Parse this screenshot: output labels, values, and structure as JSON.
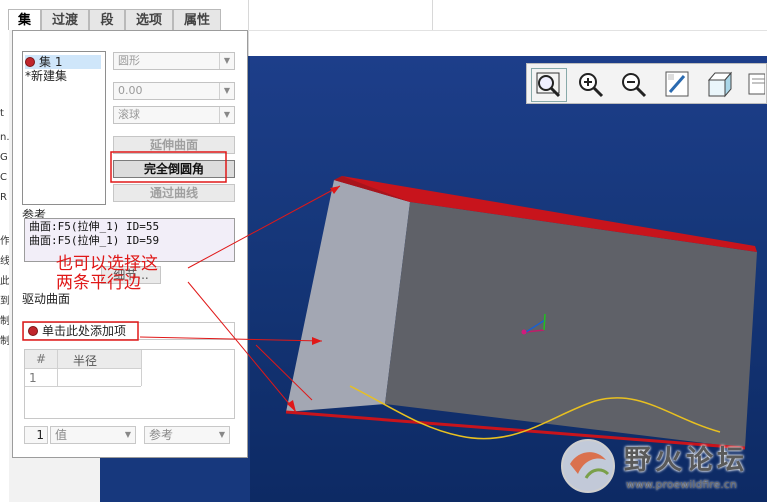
{
  "tabs": [
    {
      "label": "集",
      "active": true
    },
    {
      "label": "过渡",
      "active": false
    },
    {
      "label": "段",
      "active": false
    },
    {
      "label": "选项",
      "active": false
    },
    {
      "label": "属性",
      "active": false
    }
  ],
  "left_strip_chars": [
    "t",
    "n.",
    "G",
    "C",
    "R",
    "作",
    "线",
    "此",
    "到",
    "制",
    "制"
  ],
  "sets": [
    {
      "label": "集 1",
      "selected": true
    },
    {
      "label": "*新建集",
      "selected": false
    }
  ],
  "shape_dropdown": {
    "value": "圆形"
  },
  "value_dropdown": {
    "value": "0.00"
  },
  "method_dropdown": {
    "value": "滚球"
  },
  "buttons": {
    "extend_surface": "延伸曲面",
    "full_round": "完全倒圆角",
    "through_curve": "通过曲线"
  },
  "references": {
    "label": "参考",
    "items": [
      "曲面:F5(拉伸_1) ID=55",
      "曲面:F5(拉伸_1) ID=59"
    ],
    "details_button": "细节..."
  },
  "drive_surface": {
    "label": "驱动曲面",
    "placeholder": "单击此处添加项"
  },
  "radius_table": {
    "col_num": "#",
    "col_radius": "半径",
    "rows": [
      "1"
    ]
  },
  "bottom": {
    "index": "1",
    "type": "值",
    "ref": "参考"
  },
  "annotation": {
    "line1": "也可以选择这",
    "line2": "两条平行边"
  },
  "watermark": {
    "title": "野火论坛",
    "url": "www.proewildfire.cn"
  },
  "toolbar_icons": [
    "zoom-fit-icon",
    "zoom-in-icon",
    "zoom-out-icon",
    "repaint-icon",
    "view-orientation-icon",
    "view-list-icon"
  ],
  "colors": {
    "viewport": "#153678",
    "box_front": "#a3a7b3",
    "box_top": "#5f6168",
    "highlight_red": "#c8141c",
    "annotation": "#e01818",
    "curve": "#e8c020"
  }
}
